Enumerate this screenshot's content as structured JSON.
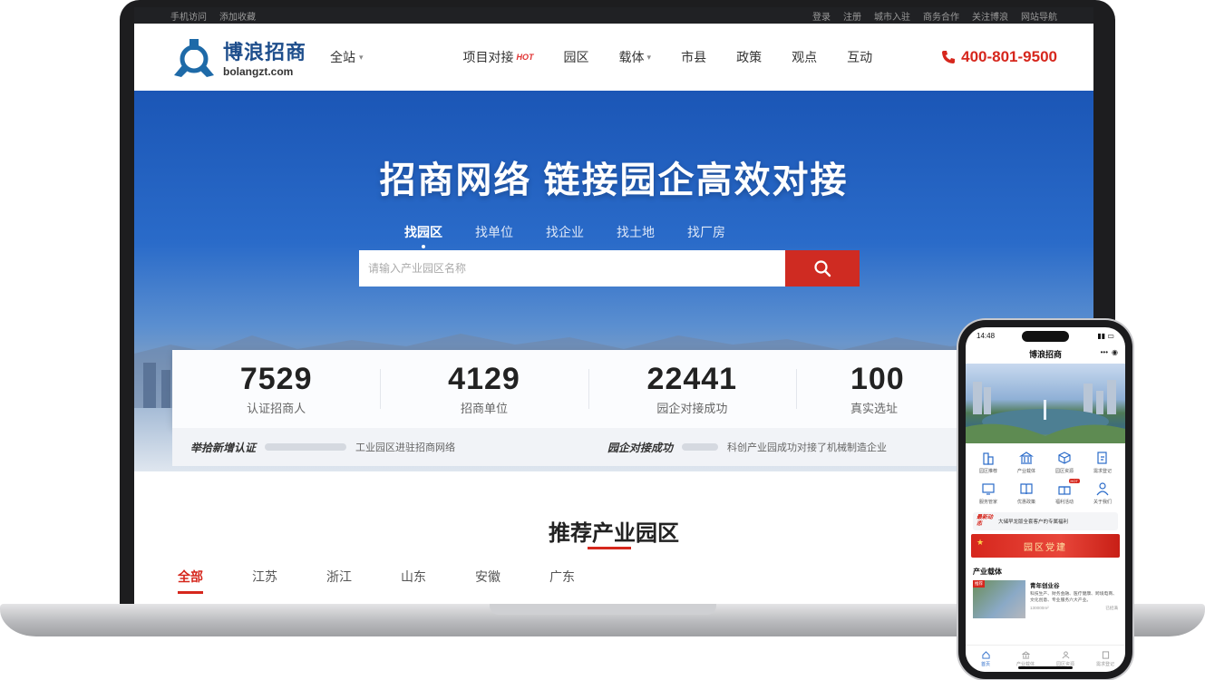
{
  "site": {
    "util_left": [
      "手机访问",
      "添加收藏"
    ],
    "util_right": [
      "登录",
      "注册",
      "城市入驻",
      "商务合作",
      "关注博浪",
      "网站导航"
    ],
    "logo_cn": "博浪招商",
    "logo_en": "bolangzt.com",
    "site_select": "全站",
    "nav": [
      {
        "label": "项目对接",
        "badge": "HOT"
      },
      {
        "label": "园区"
      },
      {
        "label": "载体",
        "dropdown": true
      },
      {
        "label": "市县"
      },
      {
        "label": "政策"
      },
      {
        "label": "观点"
      },
      {
        "label": "互动"
      }
    ],
    "phone_number": "400-801-9500",
    "accent_color": "#d6271d",
    "brand_color": "#1e4e8c"
  },
  "hero": {
    "title": "招商网络 链接园企高效对接",
    "search_tabs": [
      "找园区",
      "找单位",
      "找企业",
      "找土地",
      "找厂房"
    ],
    "active_tab": "找园区",
    "search_placeholder": "请输入产业园区名称"
  },
  "stats": [
    {
      "value": "7529",
      "label": "认证招商人"
    },
    {
      "value": "4129",
      "label": "招商单位"
    },
    {
      "value": "22441",
      "label": "园企对接成功"
    },
    {
      "value": "100",
      "label": "真实选址"
    }
  ],
  "ticker": [
    {
      "head": "举拾新增认证",
      "text": "工业园区进驻招商网络"
    },
    {
      "head": "园企对接成功",
      "text": "科创产业园成功对接了机械制造企业"
    }
  ],
  "recommend": {
    "title": "推荐产业园区",
    "regions": [
      "全部",
      "江苏",
      "浙江",
      "山东",
      "安徽",
      "广东"
    ],
    "active_region": "全部"
  },
  "mobile": {
    "time": "14:48",
    "title": "博浪招商",
    "grid": [
      {
        "label": "园区推荐",
        "icon": "building-icon"
      },
      {
        "label": "产业载体",
        "icon": "bank-icon"
      },
      {
        "label": "园区资源",
        "icon": "cube-icon"
      },
      {
        "label": "需求登记",
        "icon": "edit-icon"
      },
      {
        "label": "服务管家",
        "icon": "monitor-icon"
      },
      {
        "label": "优惠政策",
        "icon": "book-icon"
      },
      {
        "label": "福利活动",
        "icon": "gift-icon",
        "badge": "HOT"
      },
      {
        "label": "关于我们",
        "icon": "people-icon"
      }
    ],
    "news_tag": "最新动态",
    "news_text": "大储早龙版全套客户的专属福利",
    "party_banner": "园区党建",
    "section_title": "产业载体",
    "card": {
      "badge": "推荐",
      "title": "青年创业谷",
      "desc": "科技生产、财务金融、医疗健康、跨境电商、文化创意、专业服务六大产业。",
      "area": "130000m²",
      "status": "已招满"
    },
    "tabs": [
      "首页",
      "产业载体",
      "园区资源",
      "需求登记"
    ],
    "active_tab": "首页"
  }
}
